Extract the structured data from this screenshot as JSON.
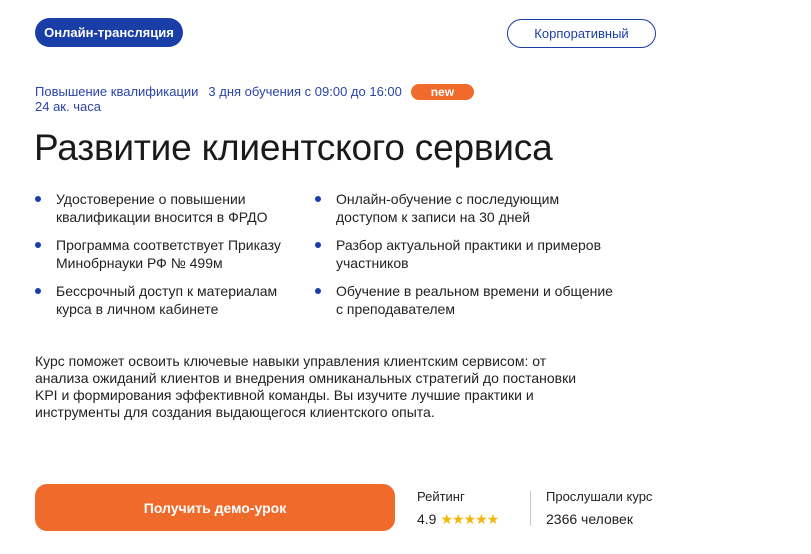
{
  "header": {
    "format_badge": "Онлайн-трансляция",
    "corporate_button": "Корпоративный"
  },
  "meta": {
    "course_type": "Повышение квалификации",
    "schedule": "3 дня обучения с 09:00 до 16:00",
    "new_badge": "new",
    "hours": "24 ак. часа"
  },
  "title": "Развитие клиентского сервиса",
  "features": {
    "left": [
      "Удостоверение о повышении квалификации вносится в ФРДО",
      "Программа соответствует Приказу Минобрнауки РФ № 499м",
      "Бессрочный доступ к материалам курса в личном кабинете"
    ],
    "right": [
      "Онлайн-обучение с последующим доступом к записи на 30 дней",
      "Разбор актуальной практики и примеров участников",
      "Обучение в реальном времени и общение с преподавателем"
    ]
  },
  "description": "Курс поможет освоить ключевые навыки управления клиентским сервисом: от анализа ожиданий клиентов и внедрения омниканальных стратегий до постановки KPI и формирования эффективной команды. Вы изучите лучшие практики и инструменты для создания выдающегося клиентского опыта.",
  "cta": {
    "demo_button": "Получить демо-урок"
  },
  "stats": {
    "rating_label": "Рейтинг",
    "rating_value": "4.9",
    "rating_stars": 5,
    "listeners_label": "Прослушали курс",
    "listeners_value": "2366 человек"
  },
  "colors": {
    "brand_blue": "#1a3ea8",
    "accent_orange": "#f06a2c",
    "star_yellow": "#f2b705"
  }
}
